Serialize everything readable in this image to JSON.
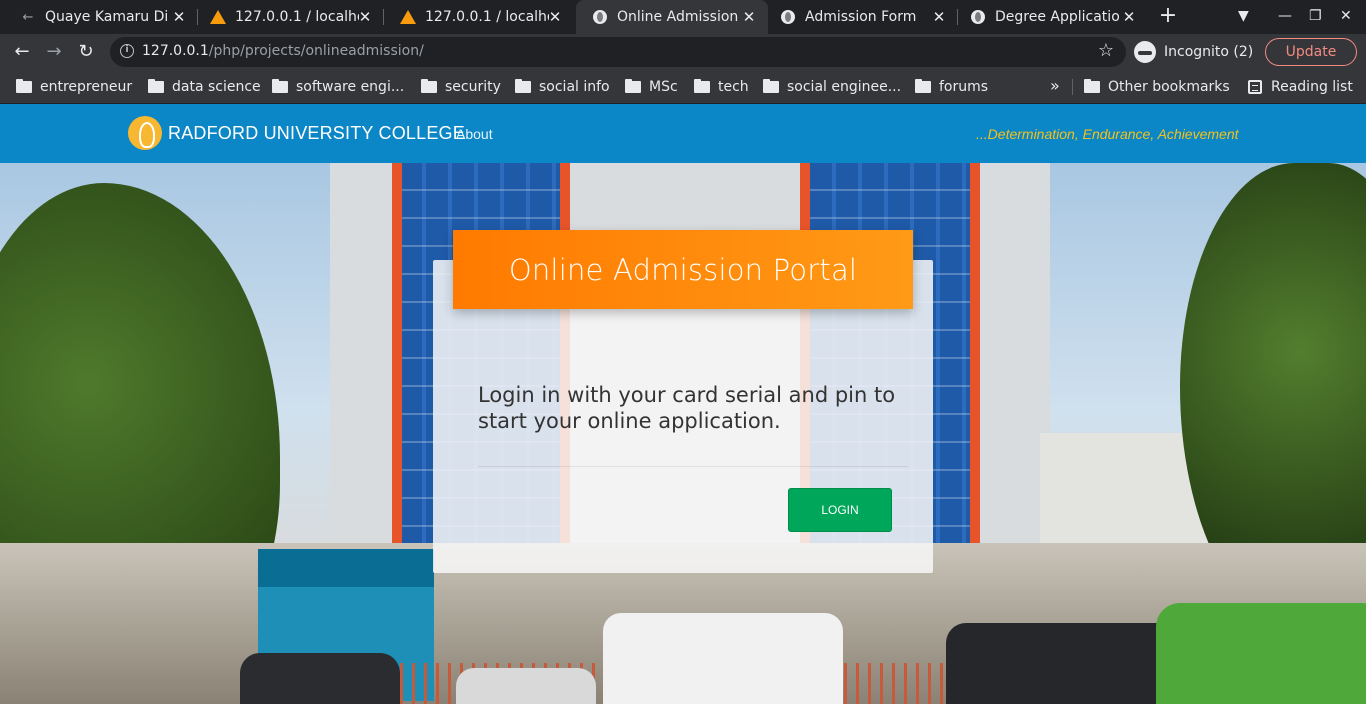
{
  "browser": {
    "tabs": [
      {
        "title": "Quaye Kamaru Din",
        "favicon": "back-arrow-icon",
        "active": false
      },
      {
        "title": "127.0.0.1 / localho",
        "favicon": "phpmyadmin-icon",
        "active": false
      },
      {
        "title": "127.0.0.1 / localho",
        "favicon": "phpmyadmin-icon",
        "active": false
      },
      {
        "title": "Online Admission",
        "favicon": "globe-icon",
        "active": true
      },
      {
        "title": "Admission Form",
        "favicon": "globe-icon",
        "active": false
      },
      {
        "title": "Degree Applicatio",
        "favicon": "globe-icon",
        "active": false
      }
    ],
    "new_tab_symbol": "+",
    "url_host": "127.0.0.1",
    "url_path": "/php/projects/onlineadmission/",
    "incognito_label": "Incognito (2)",
    "update_label": "Update",
    "bookmarks": [
      "entrepreneur",
      "data science",
      "software engi...",
      "security",
      "social info",
      "MSc",
      "tech",
      "social enginee...",
      "forums"
    ],
    "bookmarks_more": "»",
    "other_bookmarks": "Other bookmarks",
    "reading_list": "Reading list"
  },
  "site": {
    "brand": "RADFORD UNIVERSITY COLLEGE",
    "nav_about": "About",
    "motto": "...Determination, Endurance, Achievement",
    "colors": {
      "navbar": "#0b86c6",
      "header": "#ff8a0b",
      "login_button": "#00a65a",
      "motto": "#f3c21b"
    }
  },
  "login_card": {
    "title": "Online Admission Portal",
    "message": "Login in with your card serial and pin to start your online application.",
    "login_button": "LOGIN"
  }
}
